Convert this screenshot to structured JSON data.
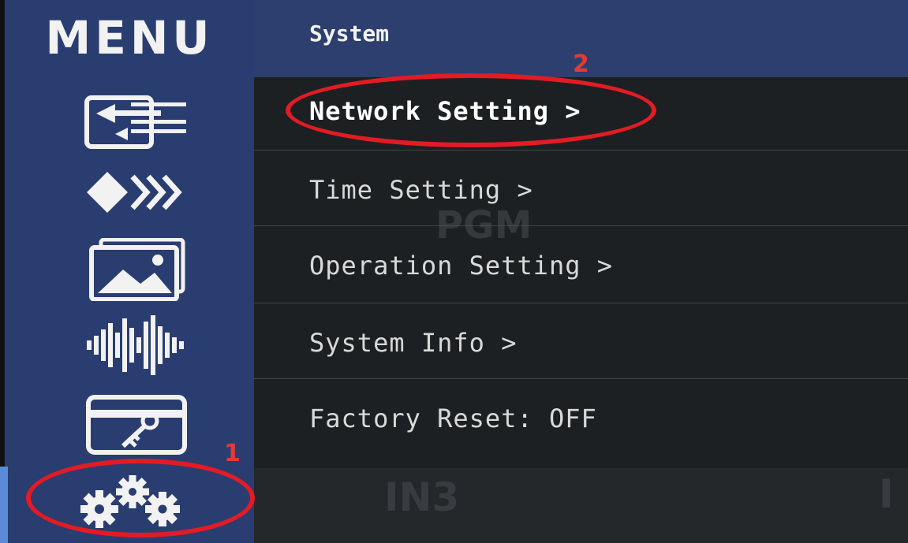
{
  "sidebar": {
    "title": "MENU",
    "icons": [
      "input-source-icon",
      "picture-mode-icon",
      "image-icon",
      "audio-icon",
      "key-card-icon",
      "gears-icon"
    ]
  },
  "header": {
    "title": "System"
  },
  "menu": {
    "items": [
      {
        "label": "Network Setting >"
      },
      {
        "label": "Time Setting >"
      },
      {
        "label": "Operation Setting >"
      },
      {
        "label": "System Info >"
      },
      {
        "label": "Factory Reset: OFF"
      }
    ]
  },
  "background": {
    "watermark_top": "PGM",
    "watermark_bottom": "IN3",
    "watermark_right": "I"
  },
  "annotations": {
    "label_1": "1",
    "label_2": "2",
    "color": "#e21b24"
  },
  "colors": {
    "sidebar": "#2a3d70",
    "header": "#2c3f6e",
    "content_bg": "#1d2022",
    "text": "#d9d9d9"
  }
}
